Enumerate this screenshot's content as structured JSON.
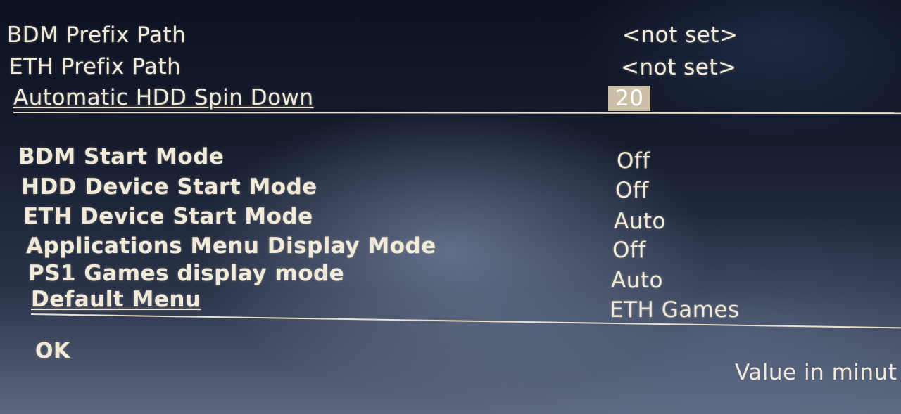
{
  "group1": [
    {
      "label": "BDM Prefix Path",
      "value": "<not set>"
    },
    {
      "label": "ETH Prefix Path",
      "value": "<not set>"
    },
    {
      "label": "Automatic HDD Spin Down",
      "value": "20"
    }
  ],
  "group2": [
    {
      "label": "BDM Start Mode",
      "value": "Off"
    },
    {
      "label": "HDD Device Start Mode",
      "value": "Off"
    },
    {
      "label": "ETH Device Start Mode",
      "value": "Auto"
    },
    {
      "label": "Applications Menu Display Mode",
      "value": "Off"
    },
    {
      "label": "PS1 Games display mode",
      "value": "Auto"
    },
    {
      "label": "Default Menu",
      "value": "ETH Games"
    }
  ],
  "ok_label": "OK",
  "hint_text": "Value in minut",
  "colors": {
    "text": "#f1ead9",
    "highlight_bg": "#cbbfa8"
  }
}
